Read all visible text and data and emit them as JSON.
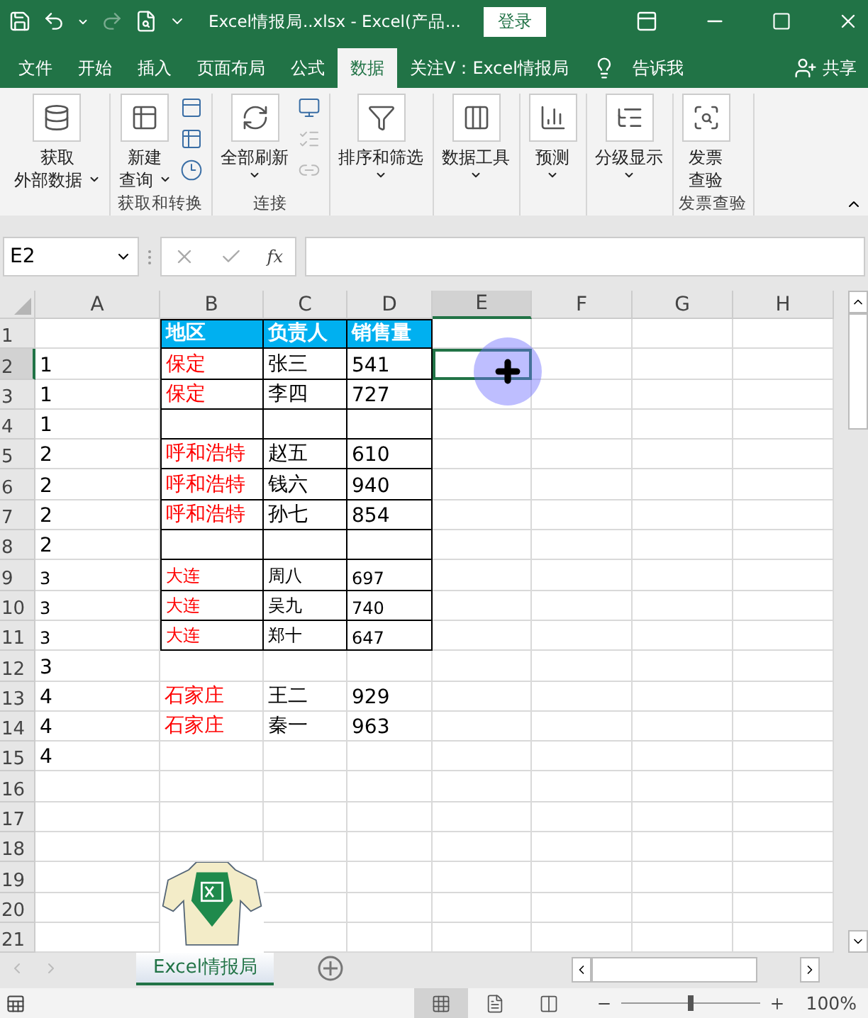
{
  "title_bar": {
    "title": "Excel情报局..xlsx  -  Excel(产品...",
    "login_button": "登录",
    "redo_disabled": true
  },
  "menu_tabs": [
    {
      "label": "文件",
      "selected": false
    },
    {
      "label": "开始",
      "selected": false
    },
    {
      "label": "插入",
      "selected": false
    },
    {
      "label": "页面布局",
      "selected": false
    },
    {
      "label": "公式",
      "selected": false
    },
    {
      "label": "数据",
      "selected": true
    },
    {
      "label": "关注V：Excel情报局",
      "selected": false
    }
  ],
  "tell_me": "告诉我",
  "share": "共享",
  "ribbon_groups": [
    {
      "buttons": [
        {
          "lines": [
            "获取",
            "外部数据"
          ],
          "has_menu": true
        }
      ]
    },
    {
      "buttons": [
        {
          "lines": [
            "新建",
            "查询"
          ],
          "has_menu": true
        }
      ],
      "small_buttons": [
        {
          "disabled": false
        },
        {
          "disabled": false
        },
        {
          "disabled": false
        }
      ],
      "label": "获取和转换"
    },
    {
      "buttons": [
        {
          "lines": [
            "全部刷新"
          ],
          "has_menu": true
        }
      ],
      "small_buttons": [
        {
          "disabled": false
        },
        {
          "disabled": true
        },
        {
          "disabled": true
        }
      ],
      "label": "连接"
    },
    {
      "buttons": [
        {
          "lines": [
            "排序和筛选"
          ],
          "has_menu": true
        }
      ]
    },
    {
      "buttons": [
        {
          "lines": [
            "数据工具"
          ],
          "has_menu": true
        }
      ]
    },
    {
      "buttons": [
        {
          "lines": [
            "预测"
          ],
          "has_menu": true
        }
      ]
    },
    {
      "buttons": [
        {
          "lines": [
            "分级显示"
          ],
          "has_menu": true
        }
      ]
    },
    {
      "buttons": [
        {
          "lines": [
            "发票",
            "查验"
          ],
          "has_menu": false
        }
      ],
      "label": "发票查验"
    }
  ],
  "formula_bar": {
    "name_box": "E2",
    "function_label": "fx"
  },
  "columns": [
    {
      "label": "A",
      "selected": false
    },
    {
      "label": "B",
      "selected": false
    },
    {
      "label": "C",
      "selected": false
    },
    {
      "label": "D",
      "selected": false
    },
    {
      "label": "E",
      "selected": true
    },
    {
      "label": "F",
      "selected": false
    },
    {
      "label": "G",
      "selected": false
    },
    {
      "label": "H",
      "selected": false
    }
  ],
  "rows": [
    {
      "number": "1",
      "selected": false,
      "kind": "header",
      "b": "地区",
      "c": "负责人",
      "d": "销售量"
    },
    {
      "number": "2",
      "selected": true,
      "kind": "boxed",
      "a": "1",
      "b": "保定",
      "c": "张三",
      "d": "541"
    },
    {
      "number": "3",
      "selected": false,
      "kind": "boxed",
      "a": "1",
      "b": "保定",
      "c": "李四",
      "d": "727"
    },
    {
      "number": "4",
      "selected": false,
      "kind": "boxed",
      "a": "1"
    },
    {
      "number": "5",
      "selected": false,
      "kind": "boxed",
      "a": "2",
      "b": "呼和浩特",
      "c": "赵五",
      "d": "610"
    },
    {
      "number": "6",
      "selected": false,
      "kind": "boxed",
      "a": "2",
      "b": "呼和浩特",
      "c": "钱六",
      "d": "940"
    },
    {
      "number": "7",
      "selected": false,
      "kind": "boxed",
      "a": "2",
      "b": "呼和浩特",
      "c": "孙七",
      "d": "854"
    },
    {
      "number": "8",
      "selected": false,
      "kind": "boxed",
      "a": "2"
    },
    {
      "number": "9",
      "selected": false,
      "kind": "boxed_small",
      "a": "3",
      "b": "大连",
      "c": "周八",
      "d": "697"
    },
    {
      "number": "10",
      "selected": false,
      "kind": "boxed_small",
      "a": "3",
      "b": "大连",
      "c": "吴九",
      "d": "740"
    },
    {
      "number": "11",
      "selected": false,
      "kind": "boxed_small",
      "a": "3",
      "b": "大连",
      "c": "郑十",
      "d": "647"
    },
    {
      "number": "12",
      "selected": false,
      "kind": "plain",
      "a": "3"
    },
    {
      "number": "13",
      "selected": false,
      "kind": "plain",
      "a": "4",
      "b": "石家庄",
      "c": "王二",
      "d": "929"
    },
    {
      "number": "14",
      "selected": false,
      "kind": "plain",
      "a": "4",
      "b": "石家庄",
      "c": "秦一",
      "d": "963"
    },
    {
      "number": "15",
      "selected": false,
      "kind": "plain",
      "a": "4"
    },
    {
      "number": "16",
      "selected": false,
      "kind": "plain"
    },
    {
      "number": "17",
      "selected": false,
      "kind": "plain"
    },
    {
      "number": "18",
      "selected": false,
      "kind": "plain"
    },
    {
      "number": "19",
      "selected": false,
      "kind": "plain"
    },
    {
      "number": "20",
      "selected": false,
      "kind": "plain"
    },
    {
      "number": "21",
      "selected": false,
      "kind": "plain"
    }
  ],
  "sheet_tabs": [
    {
      "label": "Excel情报局",
      "selected": true
    }
  ],
  "status_bar": {
    "views": [
      {
        "selected": true
      },
      {
        "selected": false
      },
      {
        "selected": false
      }
    ],
    "zoom": {
      "level": 0.5,
      "reading": "100%"
    }
  }
}
